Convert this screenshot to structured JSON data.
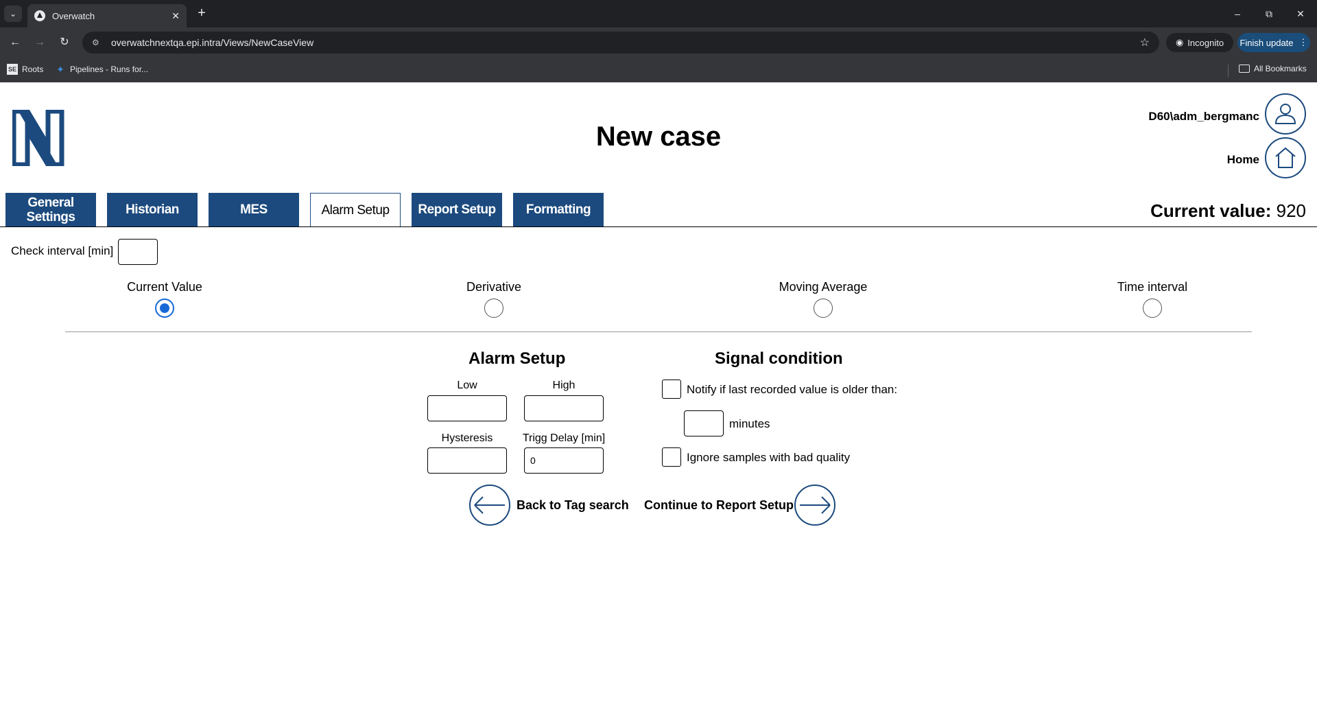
{
  "browser": {
    "tab_title": "Overwatch",
    "url": "overwatchnextqa.epi.intra/Views/NewCaseView",
    "incognito_label": "Incognito",
    "finish_update_label": "Finish update",
    "bookmarks": [
      {
        "label": "Roots"
      },
      {
        "label": "Pipelines - Runs for..."
      }
    ],
    "all_bookmarks_label": "All Bookmarks"
  },
  "header": {
    "title": "New case",
    "user_name": "D60\\adm_bergmanc",
    "home_label": "Home",
    "logo_letter": "N",
    "brand_color": "#1c4a7e"
  },
  "tabs": [
    {
      "label": "General Settings",
      "active": false
    },
    {
      "label": "Historian",
      "active": false
    },
    {
      "label": "MES",
      "active": false
    },
    {
      "label": "Alarm Setup",
      "active": true
    },
    {
      "label": "Report Setup",
      "active": false
    },
    {
      "label": "Formatting",
      "active": false
    }
  ],
  "current_value": {
    "label": "Current value:",
    "value": "920"
  },
  "check_interval": {
    "label": "Check interval [min]",
    "value": ""
  },
  "alarm_types": [
    {
      "label": "Current Value",
      "selected": true
    },
    {
      "label": "Derivative",
      "selected": false
    },
    {
      "label": "Moving Average",
      "selected": false
    },
    {
      "label": "Time interval",
      "selected": false
    }
  ],
  "alarm_setup": {
    "title": "Alarm Setup",
    "low_label": "Low",
    "low_value": "",
    "high_label": "High",
    "high_value": "",
    "hysteresis_label": "Hysteresis",
    "hysteresis_value": "",
    "trigg_delay_label": "Trigg Delay [min]",
    "trigg_delay_value": "0"
  },
  "signal_condition": {
    "title": "Signal condition",
    "notify_label": "Notify if last recorded value is older than:",
    "notify_checked": false,
    "minutes_value": "",
    "minutes_label": "minutes",
    "ignore_label": "Ignore samples with bad quality",
    "ignore_checked": false
  },
  "navigation": {
    "back_label": "Back to Tag search",
    "continue_label": "Continue to Report Setup"
  }
}
